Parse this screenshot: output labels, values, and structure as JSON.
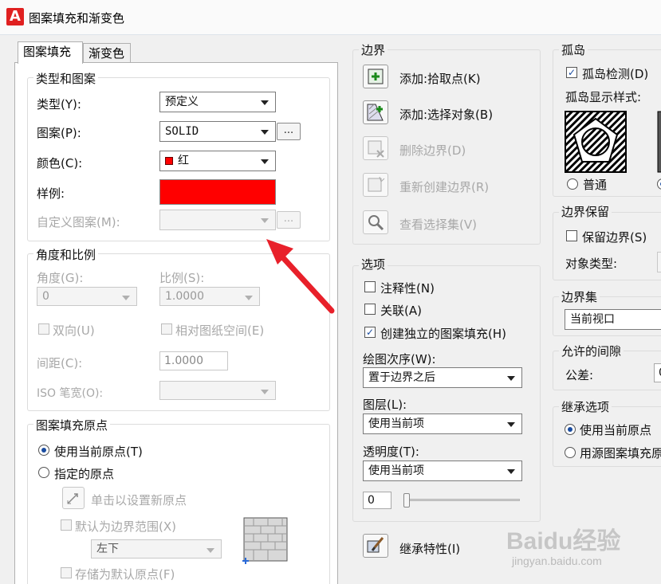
{
  "window": {
    "title": "图案填充和渐变色",
    "app_icon": "A"
  },
  "tabs": [
    "图案填充",
    "渐变色"
  ],
  "type_pattern": {
    "title": "类型和图案",
    "type_label": "类型(Y):",
    "type_value": "预定义",
    "pattern_label": "图案(P):",
    "pattern_value": "SOLID",
    "pattern_more": "...",
    "color_label": "颜色(C):",
    "color_value": "红",
    "sample_label": "样例:",
    "sample_color": "#ff0000",
    "custom_label": "自定义图案(M):",
    "custom_more": "..."
  },
  "angle_scale": {
    "title": "角度和比例",
    "angle_label": "角度(G):",
    "angle_value": "0",
    "scale_label": "比例(S):",
    "scale_value": "1.0000",
    "double_label": "双向(U)",
    "relative_label": "相对图纸空间(E)",
    "spacing_label": "间距(C):",
    "spacing_value": "1.0000",
    "iso_label": "ISO 笔宽(O):"
  },
  "origin": {
    "title": "图案填充原点",
    "use_current": "使用当前原点(T)",
    "specified": "指定的原点",
    "click_set": "单击以设置新原点",
    "default_extent": "默认为边界范围(X)",
    "position_value": "左下",
    "store_default": "存储为默认原点(F)"
  },
  "boundary": {
    "title": "边界",
    "add_pick": "添加:拾取点(K)",
    "add_select": "添加:选择对象(B)",
    "remove": "删除边界(D)",
    "recreate": "重新创建边界(R)",
    "view_sel": "查看选择集(V)"
  },
  "options": {
    "title": "选项",
    "annotative": "注释性(N)",
    "associative": "关联(A)",
    "separate": "创建独立的图案填充(H)",
    "draw_order_label": "绘图次序(W):",
    "draw_order_value": "置于边界之后",
    "layer_label": "图层(L):",
    "layer_value": "使用当前项",
    "transparency_label": "透明度(T):",
    "transparency_value": "使用当前项",
    "transparency_number": "0",
    "transparency_level": 0
  },
  "inherit": {
    "label": "继承特性(I)"
  },
  "islands": {
    "title": "孤岛",
    "detect": "孤岛检测(D)",
    "style_label": "孤岛显示样式:",
    "normal": "普通"
  },
  "retain": {
    "title": "边界保留",
    "retain_label": "保留边界(S)",
    "object_type": "对象类型:"
  },
  "boundary_set": {
    "title": "边界集",
    "value": "当前视口"
  },
  "gap": {
    "title": "允许的间隙",
    "tolerance_label": "公差:",
    "tolerance_value": "0"
  },
  "inherit_options": {
    "title": "继承选项",
    "use_current": "使用当前原点",
    "use_source": "用源图案填充原点"
  },
  "watermark": {
    "brand": "Baidu经验",
    "url": "jingyan.baidu.com"
  },
  "colors": {
    "accent": "#1a4ca0",
    "arrow": "#e8202a",
    "sample": "#ff0000"
  }
}
